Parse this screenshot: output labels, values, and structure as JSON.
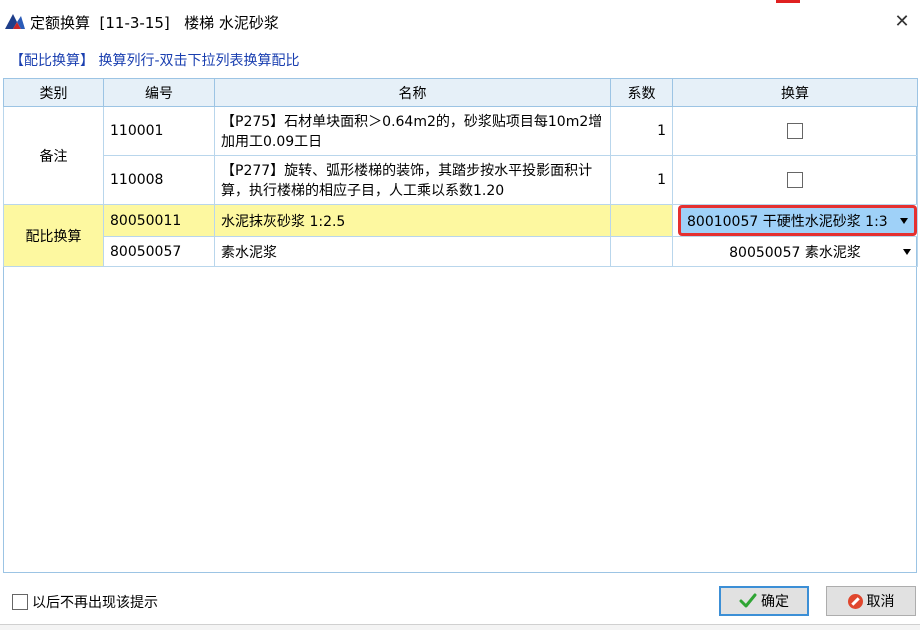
{
  "window": {
    "title": "定额换算  [11-3-15]   楼梯 水泥砂浆"
  },
  "hint": "【配比换算】 换算列行-双击下拉列表换算配比",
  "grid": {
    "headers": [
      "类别",
      "编号",
      "名称",
      "系数",
      "换算"
    ],
    "groups": [
      {
        "category": "备注"
      },
      {
        "category": "配比换算"
      }
    ],
    "rows": [
      {
        "code": "110001",
        "name": "【P275】石材单块面积＞0.64m2的，砂浆贴项目每10m2增加用工0.09工日",
        "coef": "1",
        "checked": false
      },
      {
        "code": "110008",
        "name": "【P277】旋转、弧形楼梯的装饰，其踏步按水平投影面积计算，执行楼梯的相应子目，人工乘以系数1.20",
        "coef": "1",
        "checked": false
      },
      {
        "code": "80050011",
        "name": "水泥抹灰砂浆 1:2.5",
        "coef": "",
        "conversion": "80010057  干硬性水泥砂浆 1:3"
      },
      {
        "code": "80050057",
        "name": "素水泥浆",
        "coef": "",
        "conversion": "80050057  素水泥浆"
      }
    ]
  },
  "footer": {
    "dont_show_label": "以后不再出现该提示",
    "ok_label": "确定",
    "cancel_label": "取消"
  },
  "colors": {
    "highlight_row": "#fdf8a0",
    "selected_cell": "#9fd1f8",
    "selection_border": "#e53030",
    "hint_text": "#1a3fb0"
  }
}
